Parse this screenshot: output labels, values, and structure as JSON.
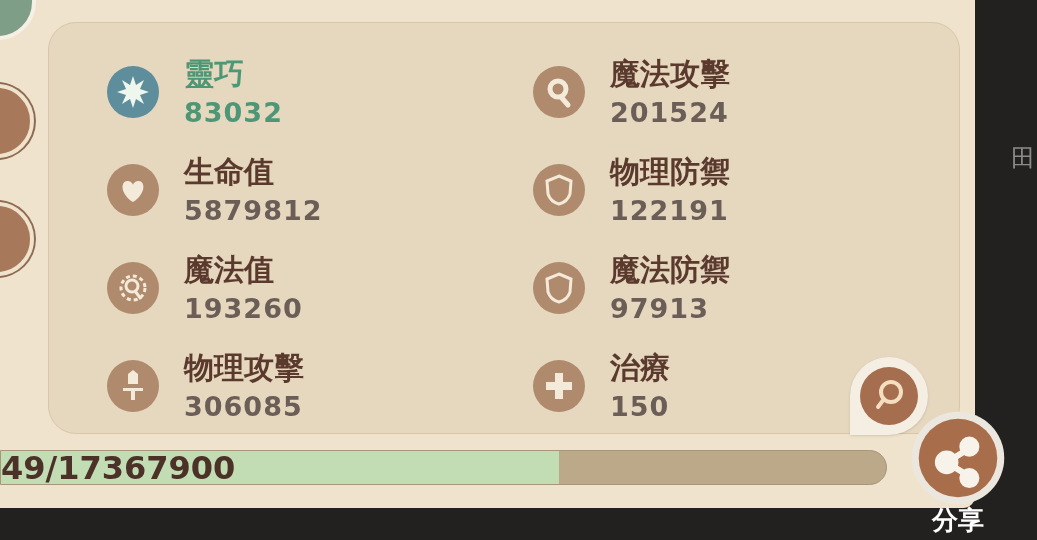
{
  "stats": [
    {
      "kind": "star",
      "label": "靈巧",
      "value": "83032",
      "color": "#5e8d9c",
      "highlighted": true
    },
    {
      "kind": "ring",
      "label": "魔法攻擊",
      "value": "201524",
      "color": "#b08a6c",
      "highlighted": false
    },
    {
      "kind": "heart",
      "label": "生命值",
      "value": "5879812",
      "color": "#b08a6c",
      "highlighted": false
    },
    {
      "kind": "shield",
      "label": "物理防禦",
      "value": "122191",
      "color": "#b08a6c",
      "highlighted": false
    },
    {
      "kind": "orb",
      "label": "魔法值",
      "value": "193260",
      "color": "#b08a6c",
      "highlighted": false
    },
    {
      "kind": "shield",
      "label": "魔法防禦",
      "value": "97913",
      "color": "#b08a6c",
      "highlighted": false
    },
    {
      "kind": "sword",
      "label": "物理攻擊",
      "value": "306085",
      "color": "#b08a6c",
      "highlighted": false
    },
    {
      "kind": "cross",
      "label": "治療",
      "value": "150",
      "color": "#b08a6c",
      "highlighted": false
    }
  ],
  "progress": {
    "reading": "49/17367900",
    "level": 0.63
  },
  "side_glyph": "田",
  "share": {
    "label": "分享"
  }
}
